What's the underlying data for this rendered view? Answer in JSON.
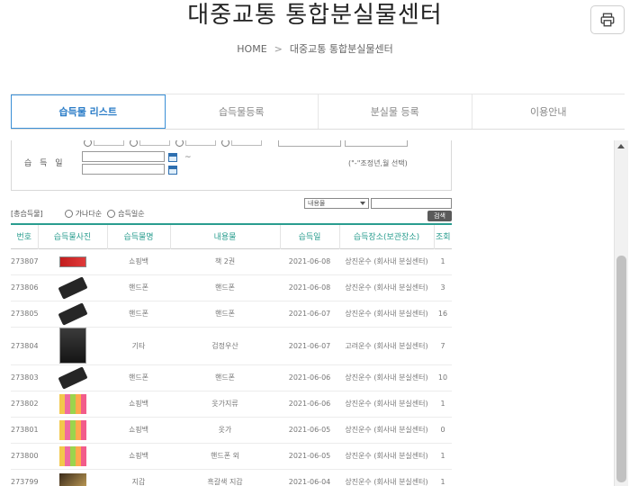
{
  "page": {
    "title": "대중교통 통합분실물센터"
  },
  "icons": {
    "print": "printer-icon",
    "calendar": "calendar-icon"
  },
  "breadcrumb": {
    "home": "HOME",
    "separator": ">",
    "current": "대중교통 통합분실물센터"
  },
  "tabs": [
    {
      "label": "습득물 리스트",
      "active": true
    },
    {
      "label": "습득물등록",
      "active": false
    },
    {
      "label": "분실물 등록",
      "active": false
    },
    {
      "label": "이용안내",
      "active": false
    }
  ],
  "filter": {
    "date_label": "습 득 일",
    "date_from": "",
    "date_to": "",
    "range_separator": "~",
    "date_hint": "(\"-\"조정년,월 선택)"
  },
  "results": {
    "label": "[총습득물]",
    "option1": "가나다순",
    "option2": "습득일순",
    "search_field": "내용물",
    "search_value": "",
    "search_button": "검색"
  },
  "table": {
    "columns": [
      "번호",
      "습득물사진",
      "습득물명",
      "내용물",
      "습득일",
      "습득장소(보관장소)",
      "조회"
    ],
    "rows": [
      {
        "id": "273807",
        "thumb": "t-wallet-red",
        "name": "쇼핑백",
        "content": "책 2권",
        "date": "2021-06-08",
        "place": "상진운수 (회사내 분실센터)",
        "views": "1"
      },
      {
        "id": "273806",
        "thumb": "t-phone",
        "name": "핸드폰",
        "content": "핸드폰",
        "date": "2021-06-08",
        "place": "상진운수 (회사내 분실센터)",
        "views": "3"
      },
      {
        "id": "273805",
        "thumb": "t-phone",
        "name": "핸드폰",
        "content": "핸드폰",
        "date": "2021-06-07",
        "place": "상진운수 (회사내 분실센터)",
        "views": "16"
      },
      {
        "id": "273804",
        "thumb": "t-umbrella",
        "name": "기타",
        "content": "검정우산",
        "date": "2021-06-07",
        "place": "고려운수 (회사내 분실센터)",
        "views": "7"
      },
      {
        "id": "273803",
        "thumb": "t-phone",
        "name": "핸드폰",
        "content": "핸드폰",
        "date": "2021-06-06",
        "place": "상진운수 (회사내 분실센터)",
        "views": "10"
      },
      {
        "id": "273802",
        "thumb": "t-bags",
        "name": "쇼핑백",
        "content": "옷가지류",
        "date": "2021-06-06",
        "place": "상진운수 (회사내 분실센터)",
        "views": "1"
      },
      {
        "id": "273801",
        "thumb": "t-bags",
        "name": "쇼핑백",
        "content": "옷가",
        "date": "2021-06-05",
        "place": "상진운수 (회사내 분실센터)",
        "views": "0"
      },
      {
        "id": "273800",
        "thumb": "t-bags",
        "name": "쇼핑백",
        "content": "핸드폰 외",
        "date": "2021-06-05",
        "place": "상진운수 (회사내 분실센터)",
        "views": "1"
      },
      {
        "id": "273799",
        "thumb": "t-wallet-dark",
        "name": "지갑",
        "content": "흑갈색 지갑",
        "date": "2021-06-04",
        "place": "상진운수 (회사내 분실센터)",
        "views": "1"
      }
    ]
  }
}
